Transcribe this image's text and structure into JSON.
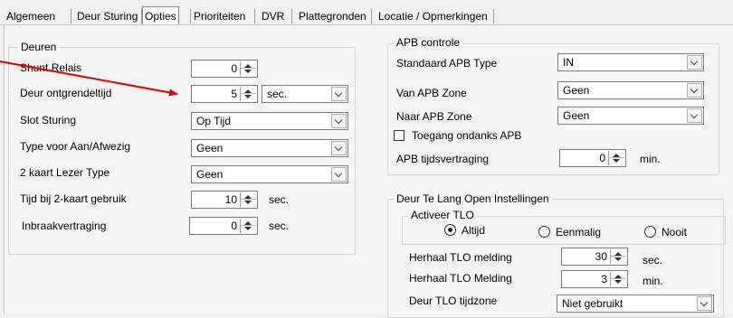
{
  "tabs": [
    "Algemeen",
    "Deur Sturing",
    "Opties",
    "Prioriteiten",
    "DVR",
    "Plattegronden",
    "Locatie / Opmerkingen"
  ],
  "active_tab": "Opties",
  "deuren": {
    "legend": "Deuren",
    "shunt_relais": {
      "label": "Shunt Relais",
      "value": "0"
    },
    "deur_ontgrendeltijd": {
      "label": "Deur ontgrendeltijd",
      "value": "5",
      "unit": "sec."
    },
    "slot_sturing": {
      "label": "Slot Sturing",
      "value": "Op Tijd"
    },
    "type_aan_afwezig": {
      "label": "Type voor Aan/Afwezig",
      "value": "Geen"
    },
    "kaart_lezer_type": {
      "label": "2 kaart Lezer Type",
      "value": "Geen"
    },
    "tijd_2kaart": {
      "label": "Tijd bij 2-kaart gebruik",
      "value": "10",
      "unit": "sec."
    },
    "inbraakvertraging": {
      "label": "Inbraakvertraging",
      "value": "0",
      "unit": "sec."
    }
  },
  "apb": {
    "legend": "APB controle",
    "standaard_type": {
      "label": "Standaard APB Type",
      "value": "IN"
    },
    "van_zone": {
      "label": "Van APB Zone",
      "value": "Geen"
    },
    "naar_zone": {
      "label": "Naar APB Zone",
      "value": "Geen"
    },
    "toegang_ondanks": {
      "label": "Toegang ondanks APB",
      "checked": false
    },
    "tijdsvertraging": {
      "label": "APB tijdsvertraging",
      "value": "0",
      "unit": "min."
    }
  },
  "tlo": {
    "legend": "Deur Te Lang Open Instellingen",
    "activeer": {
      "legend": "Activeer TLO",
      "options": [
        "Altijd",
        "Eenmalig",
        "Nooit"
      ],
      "selected": "Altijd"
    },
    "herhaal_melding": {
      "label": "Herhaal TLO melding",
      "value": "30",
      "unit": "sec."
    },
    "herhaal_melding_min": {
      "label": "Herhaal TLO Melding",
      "value": "3",
      "unit": "min."
    },
    "tijdzone": {
      "label": "Deur TLO tijdzone",
      "value": "Niet gebruikt"
    }
  },
  "colors": {
    "annotation_arrow": "#e00000"
  }
}
